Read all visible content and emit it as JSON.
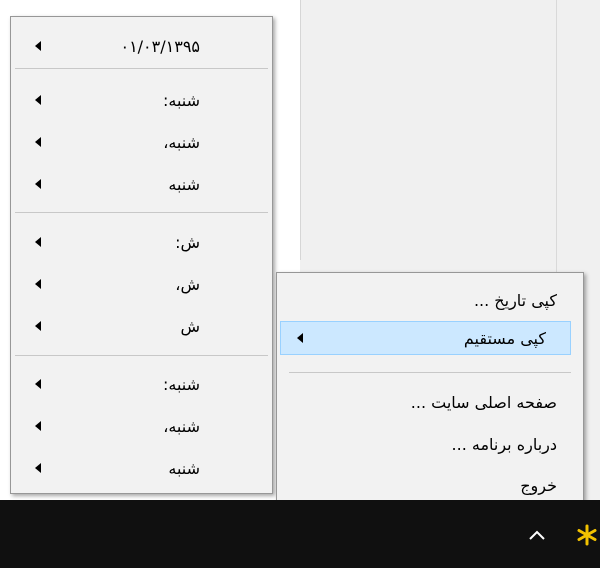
{
  "date_menu": {
    "items": [
      {
        "label": "۰۱/۰۳/۱۳۹۵",
        "has_submenu": true
      },
      {
        "label": "شنبه:",
        "has_submenu": true
      },
      {
        "label": "شنبه،",
        "has_submenu": true
      },
      {
        "label": "شنبه",
        "has_submenu": true
      },
      {
        "label": "ش:",
        "has_submenu": true
      },
      {
        "label": "ش،",
        "has_submenu": true
      },
      {
        "label": "ش",
        "has_submenu": true
      },
      {
        "label": "شنبه:",
        "has_submenu": true
      },
      {
        "label": "شنبه،",
        "has_submenu": true
      },
      {
        "label": "شنبه",
        "has_submenu": true
      }
    ]
  },
  "context_menu": {
    "items": [
      {
        "label": "کپی تاریخ ..."
      },
      {
        "label": "کپی مستقیم",
        "has_submenu": true,
        "highlighted": true
      },
      {
        "label": "صفحه اصلی سایت ..."
      },
      {
        "label": "درباره برنامه ..."
      },
      {
        "label": "خروج"
      }
    ]
  },
  "taskbar": {
    "tray_icons": [
      "chevron-up-icon",
      "star-icon"
    ]
  },
  "colors": {
    "menu_bg": "#f2f2f2",
    "highlight_bg": "#cce8ff",
    "highlight_border": "#99d1ff",
    "taskbar_bg": "#101010",
    "star": "#f2c200"
  }
}
